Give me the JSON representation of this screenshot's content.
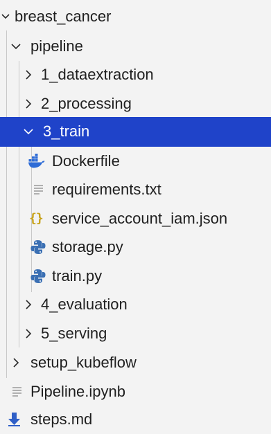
{
  "explorer": {
    "root": {
      "label": "breast_cancer"
    },
    "pipeline": {
      "label": "pipeline"
    },
    "folder_1": {
      "label": "1_dataextraction"
    },
    "folder_2": {
      "label": "2_processing"
    },
    "folder_3": {
      "label": "3_train"
    },
    "train_files": [
      {
        "label": "Dockerfile",
        "icon": "docker-icon"
      },
      {
        "label": "requirements.txt",
        "icon": "text-file-icon"
      },
      {
        "label": "service_account_iam.json",
        "icon": "json-braces-icon"
      },
      {
        "label": "storage.py",
        "icon": "python-icon"
      },
      {
        "label": "train.py",
        "icon": "python-icon"
      }
    ],
    "folder_4": {
      "label": "4_evaluation"
    },
    "folder_5": {
      "label": "5_serving"
    },
    "setup_kubeflow": {
      "label": "setup_kubeflow"
    },
    "pipeline_notebook": {
      "label": "Pipeline.ipynb",
      "icon": "text-file-icon"
    },
    "steps_md": {
      "label": "steps.md",
      "icon": "markdown-download-icon"
    },
    "selected_item": "3_train"
  },
  "colors": {
    "background": "#f3f3f3",
    "selection": "#1f43c9",
    "selection_text": "#ffffff",
    "text": "#1f1f1f",
    "docker_blue": "#2d6bd6",
    "python_blue": "#3a6fb3",
    "json_yellow": "#c7a21a",
    "markdown_blue": "#2f5fc7",
    "muted_icon": "#9a9a9a"
  }
}
